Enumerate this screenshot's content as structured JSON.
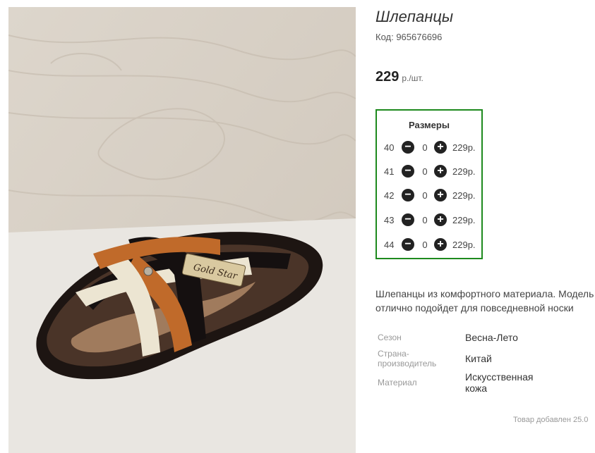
{
  "product": {
    "title": "Шлепанцы",
    "code": "Код: 965676696",
    "price": "229",
    "price_unit": "р./шт."
  },
  "sizes": {
    "heading": "Размеры",
    "rows": [
      {
        "size": "40",
        "qty": "0",
        "price": "229р."
      },
      {
        "size": "41",
        "qty": "0",
        "price": "229р."
      },
      {
        "size": "42",
        "qty": "0",
        "price": "229р."
      },
      {
        "size": "43",
        "qty": "0",
        "price": "229р."
      },
      {
        "size": "44",
        "qty": "0",
        "price": "229р."
      }
    ]
  },
  "description": {
    "line1": "Шлепанцы из комфортного материала. Модель",
    "line2": "отлично подойдет для повседневной носки"
  },
  "specs": [
    {
      "label": "Сезон",
      "value": "Весна-Лето"
    },
    {
      "label_line1": "Страна-",
      "label_line2": "производитель",
      "value": "Китай"
    },
    {
      "label": "Материал",
      "value_line1": "Искусственная",
      "value_line2": "кожа"
    }
  ],
  "added": "Товар добавлен 25.0",
  "photo": {
    "brand_text": "Gold Star"
  },
  "icons": {
    "minus": "minus-circle-icon",
    "plus": "plus-circle-icon"
  },
  "colors": {
    "accent_border": "#1e8a1e",
    "button": "#222222"
  }
}
